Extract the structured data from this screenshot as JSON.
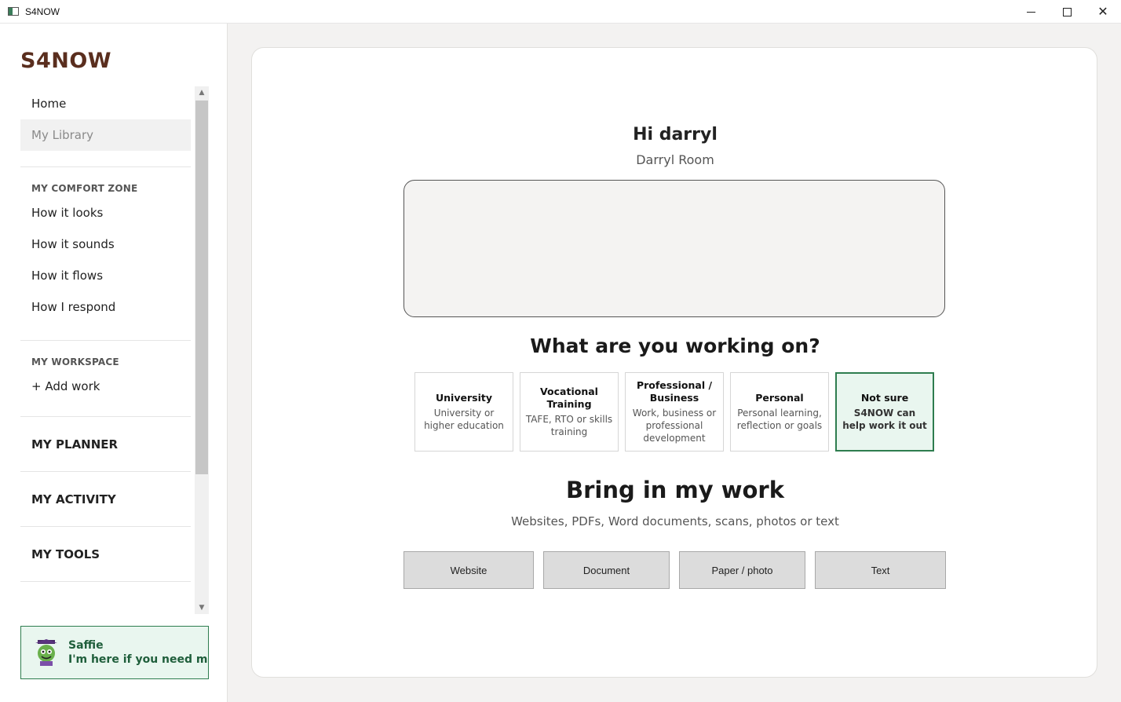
{
  "window": {
    "title": "S4NOW",
    "minimize_label": "",
    "maximize_label": "",
    "close_label": "✕"
  },
  "sidebar": {
    "logo": "S4NOW",
    "top_items": [
      {
        "label": "Home",
        "active": false
      },
      {
        "label": "My Library",
        "active": true
      }
    ],
    "comfort_zone": {
      "heading": "MY COMFORT ZONE",
      "items": [
        "How it looks",
        "How it sounds",
        "How it flows",
        "How I respond"
      ]
    },
    "workspace": {
      "heading": "MY WORKSPACE",
      "items": [
        "+ Add work"
      ]
    },
    "sections": [
      "MY PLANNER",
      "MY ACTIVITY",
      "MY TOOLS"
    ],
    "assistant": {
      "name": "Saffie",
      "message": "I'm here if you need me"
    }
  },
  "main": {
    "greeting": "Hi darryl",
    "full_name": "Darryl Room",
    "working_title": "What are you working on?",
    "options": [
      {
        "title": "University",
        "desc": "University or higher education",
        "selected": false
      },
      {
        "title": "Vocational Training",
        "desc": "TAFE, RTO or skills training",
        "selected": false
      },
      {
        "title": "Professional / Business",
        "desc": "Work, business or professional development",
        "selected": false
      },
      {
        "title": "Personal",
        "desc": "Personal learning, reflection or goals",
        "selected": false
      },
      {
        "title": "Not sure",
        "desc": "S4NOW can help work it out",
        "selected": true
      }
    ],
    "bring_title": "Bring in my work",
    "bring_subtitle": "Websites, PDFs, Word documents, scans, photos or text",
    "import_buttons": [
      "Website",
      "Document",
      "Paper / photo",
      "Text"
    ]
  },
  "colors": {
    "brand": "#5a2e1e",
    "accent_green": "#2e7d4f",
    "accent_bg": "#e9f6ef"
  }
}
